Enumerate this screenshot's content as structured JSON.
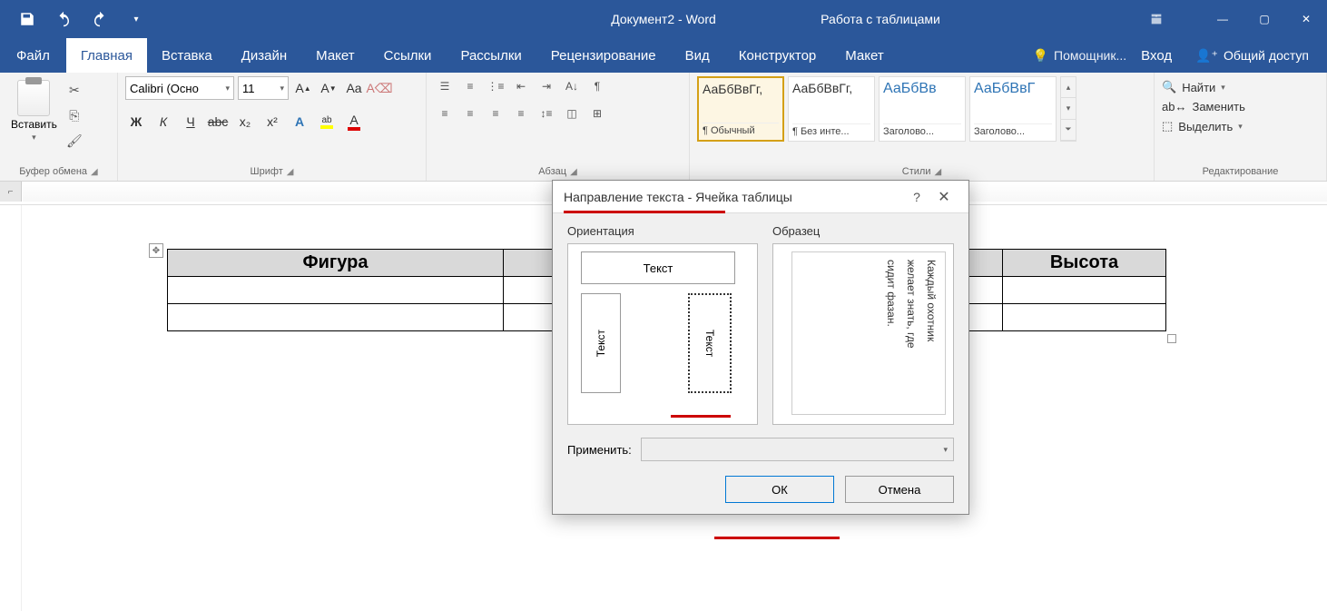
{
  "titlebar": {
    "doc_title": "Документ2 - Word",
    "context_title": "Работа с таблицами"
  },
  "tabs": {
    "file": "Файл",
    "home": "Главная",
    "insert": "Вставка",
    "design": "Дизайн",
    "layout": "Макет",
    "references": "Ссылки",
    "mailings": "Рассылки",
    "review": "Рецензирование",
    "view": "Вид",
    "tbl_design": "Конструктор",
    "tbl_layout": "Макет",
    "tell_me": "Помощник...",
    "sign_in": "Вход",
    "share": "Общий доступ"
  },
  "ribbon": {
    "clipboard": {
      "label": "Буфер обмена",
      "paste": "Вставить"
    },
    "font": {
      "label": "Шрифт",
      "name": "Calibri (Осно",
      "size": "11",
      "bold": "Ж",
      "italic": "К",
      "underline": "Ч",
      "strike": "abc",
      "sub": "x₂",
      "sup": "x²",
      "grow": "A",
      "shrink": "A",
      "case": "Aa",
      "clear": "A",
      "effects": "A",
      "highlight": "abc",
      "color": "A"
    },
    "paragraph": {
      "label": "Абзац"
    },
    "styles": {
      "label": "Стили",
      "preview": "АаБбВвГг,",
      "preview_blue": "АаБбВв",
      "preview_blue2": "АаБбВвГ",
      "s1": "¶ Обычный",
      "s2": "¶ Без инте...",
      "s3": "Заголово...",
      "s4": "Заголово..."
    },
    "editing": {
      "label": "Редактирование",
      "find": "Найти",
      "replace": "Заменить",
      "select": "Выделить"
    }
  },
  "table": {
    "col1": "Фигура",
    "col4": "Высота"
  },
  "dialog": {
    "title": "Направление текста - Ячейка таблицы",
    "orientation": "Ориентация",
    "sample": "Образец",
    "text": "Текст",
    "sample_line1": "Каждый охотник",
    "sample_line2": "желает знать, где",
    "sample_line3": "сидит фазан.",
    "apply_to": "Применить:",
    "ok": "ОК",
    "cancel": "Отмена"
  }
}
